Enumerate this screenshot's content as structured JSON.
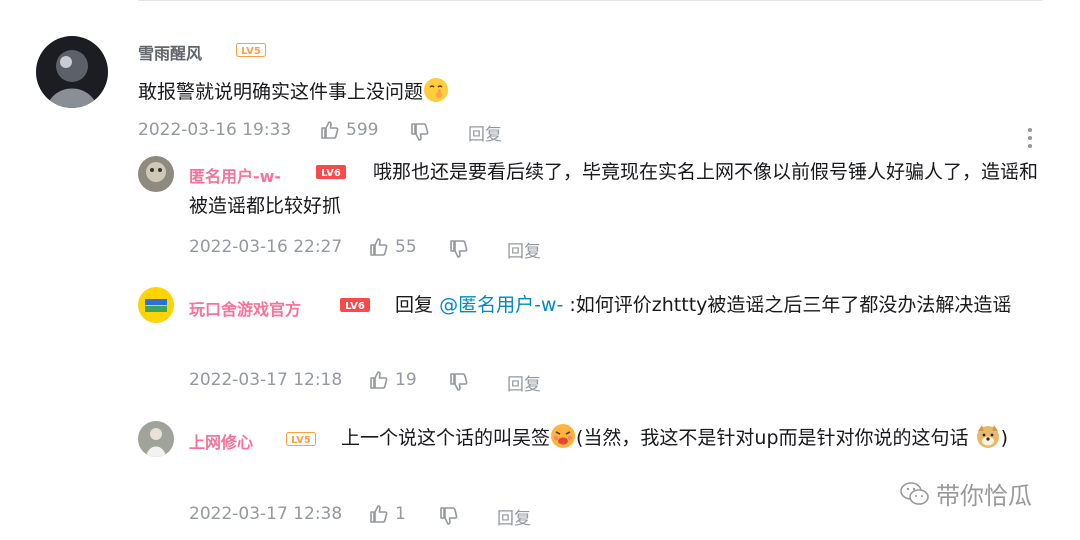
{
  "comment": {
    "username": "雪雨醒风",
    "level": "LV5",
    "text": "敢报警就说明确实这件事上没问题",
    "time": "2022-03-16 19:33",
    "likes": "599",
    "reply_label": "回复"
  },
  "replies": [
    {
      "username": "匿名用户-w-",
      "level": "LV6",
      "text": "哦那也还是要看后续了，毕竟现在实名上网不像以前假号锤人好骗人了，造谣和被造谣都比较好抓",
      "time": "2022-03-16 22:27",
      "likes": "55",
      "reply_label": "回复"
    },
    {
      "username": "玩口舍游戏官方",
      "level": "LV6",
      "prefix": "回复",
      "mention": "@匿名用户-w-",
      "text": ":如何评价zhttty被造谣之后三年了都没办法解决造谣",
      "time": "2022-03-17 12:18",
      "likes": "19",
      "reply_label": "回复"
    },
    {
      "username": "上网修心",
      "level": "LV5",
      "text_a": "上一个说这个话的叫吴签",
      "text_b": "(当然，我这不是针对up而是针对你说的这句话",
      "text_c": ")",
      "time": "2022-03-17 12:38",
      "likes": "1",
      "reply_label": "回复"
    }
  ],
  "watermark": "带你恰瓜",
  "colors": {
    "pink": "#fb7299",
    "link": "#008ac5",
    "meta": "#9499a0",
    "lv5": "#ff9f45",
    "lv6": "#fb4848"
  },
  "icons": [
    "thumb-up-icon",
    "thumb-down-icon",
    "more-vertical-icon",
    "wechat-icon"
  ]
}
